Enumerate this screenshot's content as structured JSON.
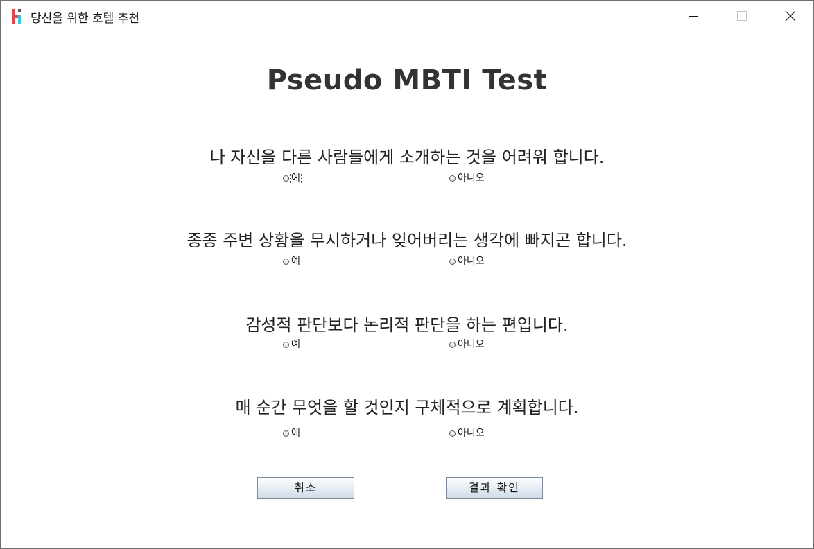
{
  "window": {
    "title": "당신을 위한 호텔 추천"
  },
  "heading": "Pseudo MBTI Test",
  "questions": [
    {
      "text": "나 자신을 다른 사람들에게 소개하는 것을 어려워 합니다.",
      "yes": "예",
      "no": "아니오"
    },
    {
      "text": "종종 주변 상황을 무시하거나 잊어버리는 생각에 빠지곤 합니다.",
      "yes": "예",
      "no": "아니오"
    },
    {
      "text": "감성적 판단보다 논리적 판단을 하는 편입니다.",
      "yes": "예",
      "no": "아니오"
    },
    {
      "text": "매 순간 무엇을 할 것인지 구체적으로 계획합니다.",
      "yes": "예",
      "no": "아니오"
    }
  ],
  "buttons": {
    "cancel": "취소",
    "confirm": "결과 확인"
  },
  "colors": {
    "icon_red": "#e0474c",
    "icon_cyan": "#3cc4d9",
    "icon_dark": "#555555"
  }
}
